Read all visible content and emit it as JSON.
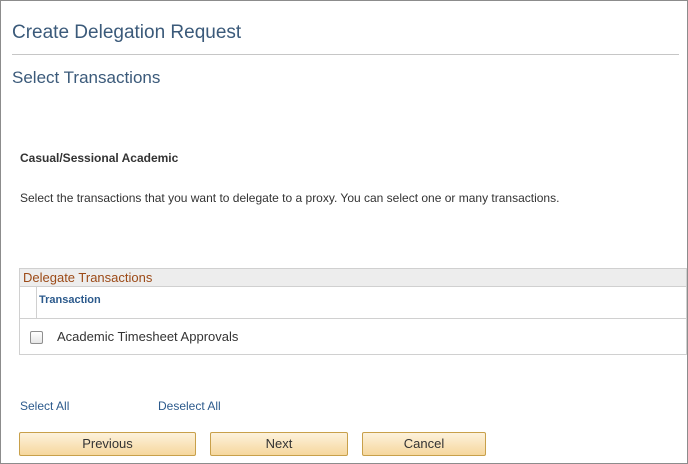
{
  "page": {
    "title": "Create Delegation Request",
    "section_title": "Select Transactions",
    "role_label": "Casual/Sessional Academic",
    "instructions": "Select the transactions that you want to delegate to a proxy. You can select one or many transactions."
  },
  "grid": {
    "title": "Delegate Transactions",
    "column_header": "Transaction",
    "rows": [
      {
        "label": "Academic Timesheet Approvals",
        "checked": false
      }
    ]
  },
  "links": {
    "select_all": "Select All",
    "deselect_all": "Deselect All"
  },
  "buttons": {
    "previous": "Previous",
    "next": "Next",
    "cancel": "Cancel"
  },
  "colors": {
    "title_text": "#3b5a7a",
    "grid_title_text": "#9c4a17",
    "link_text": "#2c5a8c",
    "button_bg": "#f6d79d"
  }
}
